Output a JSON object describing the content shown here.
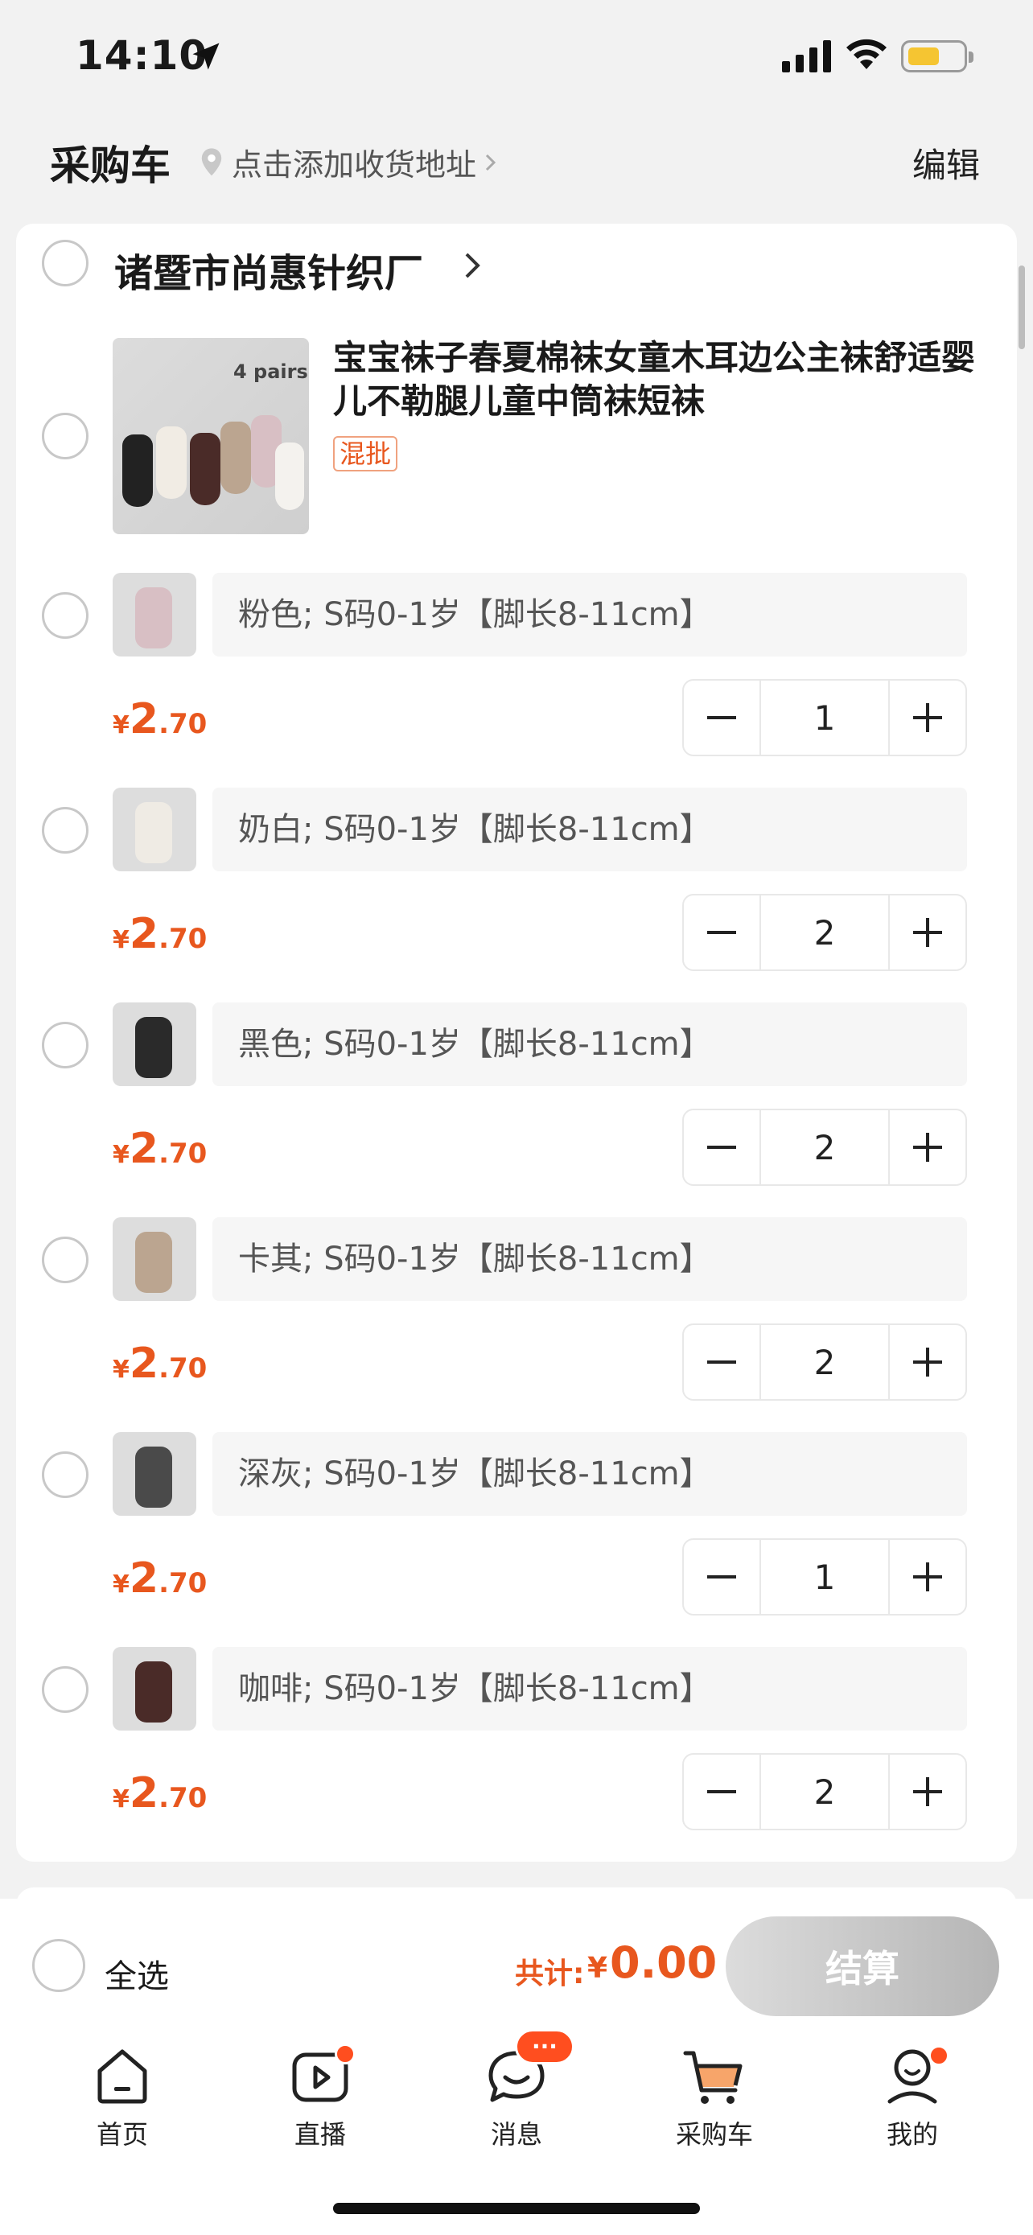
{
  "status_bar": {
    "time": "14:10"
  },
  "header": {
    "title": "采购车",
    "address": "点击添加收货地址",
    "edit": "编辑"
  },
  "shop": {
    "name": "诸暨市尚惠针织厂"
  },
  "product": {
    "title": "宝宝袜子春夏棉袜女童木耳边公主袜舒适婴儿不勒腿儿童中筒袜短袜",
    "tag": "混批",
    "image_text": "4 pairs"
  },
  "variants": [
    {
      "spec": "粉色; S码0-1岁【脚长8-11cm】",
      "currency": "¥",
      "price_int": "2",
      "price_dec": ".70",
      "qty": "1",
      "color": "#d8bfc4"
    },
    {
      "spec": "奶白; S码0-1岁【脚长8-11cm】",
      "currency": "¥",
      "price_int": "2",
      "price_dec": ".70",
      "qty": "2",
      "color": "#efebe4"
    },
    {
      "spec": "黑色; S码0-1岁【脚长8-11cm】",
      "currency": "¥",
      "price_int": "2",
      "price_dec": ".70",
      "qty": "2",
      "color": "#2a2a2a"
    },
    {
      "spec": "卡其; S码0-1岁【脚长8-11cm】",
      "currency": "¥",
      "price_int": "2",
      "price_dec": ".70",
      "qty": "2",
      "color": "#bba590"
    },
    {
      "spec": "深灰; S码0-1岁【脚长8-11cm】",
      "currency": "¥",
      "price_int": "2",
      "price_dec": ".70",
      "qty": "1",
      "color": "#4a4a4a"
    },
    {
      "spec": "咖啡; S码0-1岁【脚长8-11cm】",
      "currency": "¥",
      "price_int": "2",
      "price_dec": ".70",
      "qty": "2",
      "color": "#4a2b28"
    }
  ],
  "footer": {
    "select_all": "全选",
    "total_label": "共计:",
    "total_currency": "¥",
    "total_value": "0.00",
    "checkout": "结算"
  },
  "tabs": [
    {
      "label": "首页",
      "icon": "home-icon"
    },
    {
      "label": "直播",
      "icon": "live-icon"
    },
    {
      "label": "消息",
      "icon": "message-icon",
      "badge": "···"
    },
    {
      "label": "采购车",
      "icon": "cart-icon"
    },
    {
      "label": "我的",
      "icon": "profile-icon"
    }
  ],
  "colors": {
    "accent": "#e8571e",
    "checkout_bg": "#c8c8c8",
    "badge": "#ff4e1f"
  }
}
